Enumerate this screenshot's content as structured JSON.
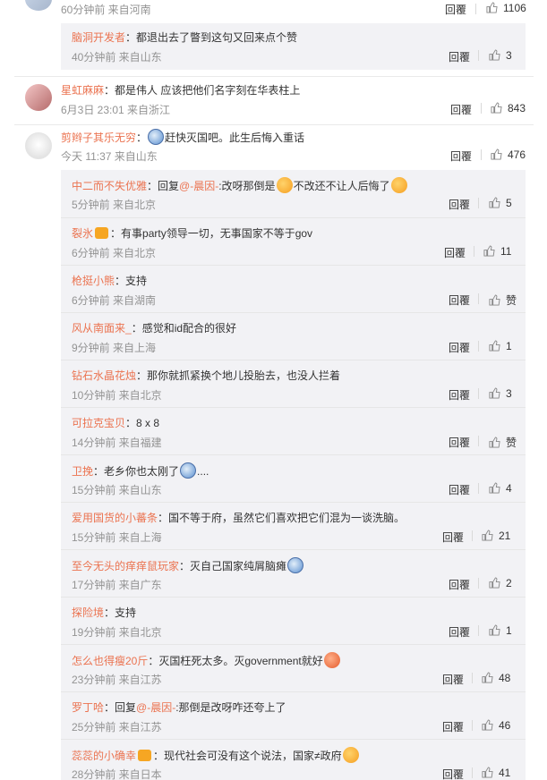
{
  "top": {
    "time": "60分钟前 来自河南",
    "reply": "回覆",
    "likes": "1106"
  },
  "nested_top": {
    "user": "脑洞开发者",
    "text": "：都退出去了瞥到这句又回来点个赞",
    "meta": "40分钟前 来自山东",
    "reply": "回覆",
    "likes": "3"
  },
  "comment1": {
    "user": "星虹麻麻",
    "text": "：都是伟人 应该把他们名字刻在华表柱上",
    "meta": "6月3日 23:01 来自浙江",
    "reply": "回覆",
    "likes": "843"
  },
  "comment2": {
    "user": "剪辫子其乐无穷",
    "text": "赶快灭国吧。此生后悔入重话",
    "meta": "今天 11:37 来自山东",
    "reply": "回覆",
    "likes": "476"
  },
  "replies": [
    {
      "user": "中二而不失优雅",
      "pre": "：回复",
      "at": "@-晨因-",
      "mid": ":改呀那倒是",
      "post": "不改还不让人后悔了",
      "meta": "5分钟前 来自北京",
      "reply": "回覆",
      "likes": "5"
    },
    {
      "user": "裂氷",
      "text": "：有事party领导一切，无事国家不等于gov",
      "meta": "6分钟前 来自北京",
      "reply": "回覆",
      "likes": "11"
    },
    {
      "user": "枪挺小熊",
      "text": "：支持",
      "meta": "6分钟前 来自湖南",
      "reply": "回覆",
      "likes": "赞"
    },
    {
      "user": "风从南面来_",
      "text": "：感觉和id配合的很好",
      "meta": "9分钟前 来自上海",
      "reply": "回覆",
      "likes": "1"
    },
    {
      "user": "钻石水晶花烛",
      "text": "：那你就抓紧换个地儿投胎去，也没人拦着",
      "meta": "10分钟前 来自北京",
      "reply": "回覆",
      "likes": "3"
    },
    {
      "user": "可拉克宝贝",
      "text": "：8 x 8",
      "meta": "14分钟前 来自福建",
      "reply": "回覆",
      "likes": "赞"
    },
    {
      "user": "卫挽",
      "text": "：老乡你也太刚了",
      "tail": "....",
      "meta": "15分钟前 来自山东",
      "reply": "回覆",
      "likes": "4"
    },
    {
      "user": "爱用国货的小蕃条",
      "text": "：国不等于府，虽然它们喜欢把它们混为一谈洗脑。",
      "meta": "15分钟前 来自上海",
      "reply": "回覆",
      "likes": "21"
    },
    {
      "user": "至今无头的痒痒鼠玩家",
      "text": "：灭自己国家纯屑脑瘫",
      "meta": "17分钟前 来自广东",
      "reply": "回覆",
      "likes": "2"
    },
    {
      "user": "探险境",
      "text": "：支持",
      "meta": "19分钟前 来自北京",
      "reply": "回覆",
      "likes": "1"
    },
    {
      "user": "怎么也得瘦20斤",
      "text": "：灭国枉死太多。灭government就好",
      "meta": "23分钟前 来自江苏",
      "reply": "回覆",
      "likes": "48"
    },
    {
      "user": "罗丁哈",
      "pre": "：回复",
      "at": "@-晨因-",
      "mid": ":那倒是改呀咋还夸上了",
      "post": "",
      "meta": "25分钟前 来自江苏",
      "reply": "回覆",
      "likes": "46"
    },
    {
      "user": "蕊蕊的小确幸",
      "text": "：现代社会可没有这个说法，国家≠政府",
      "meta": "28分钟前 来自日本",
      "reply": "回覆",
      "likes": "41"
    }
  ],
  "colors": {
    "username": "#eb7350",
    "meta": "#939393",
    "sub_bg": "#f2f2f5"
  }
}
